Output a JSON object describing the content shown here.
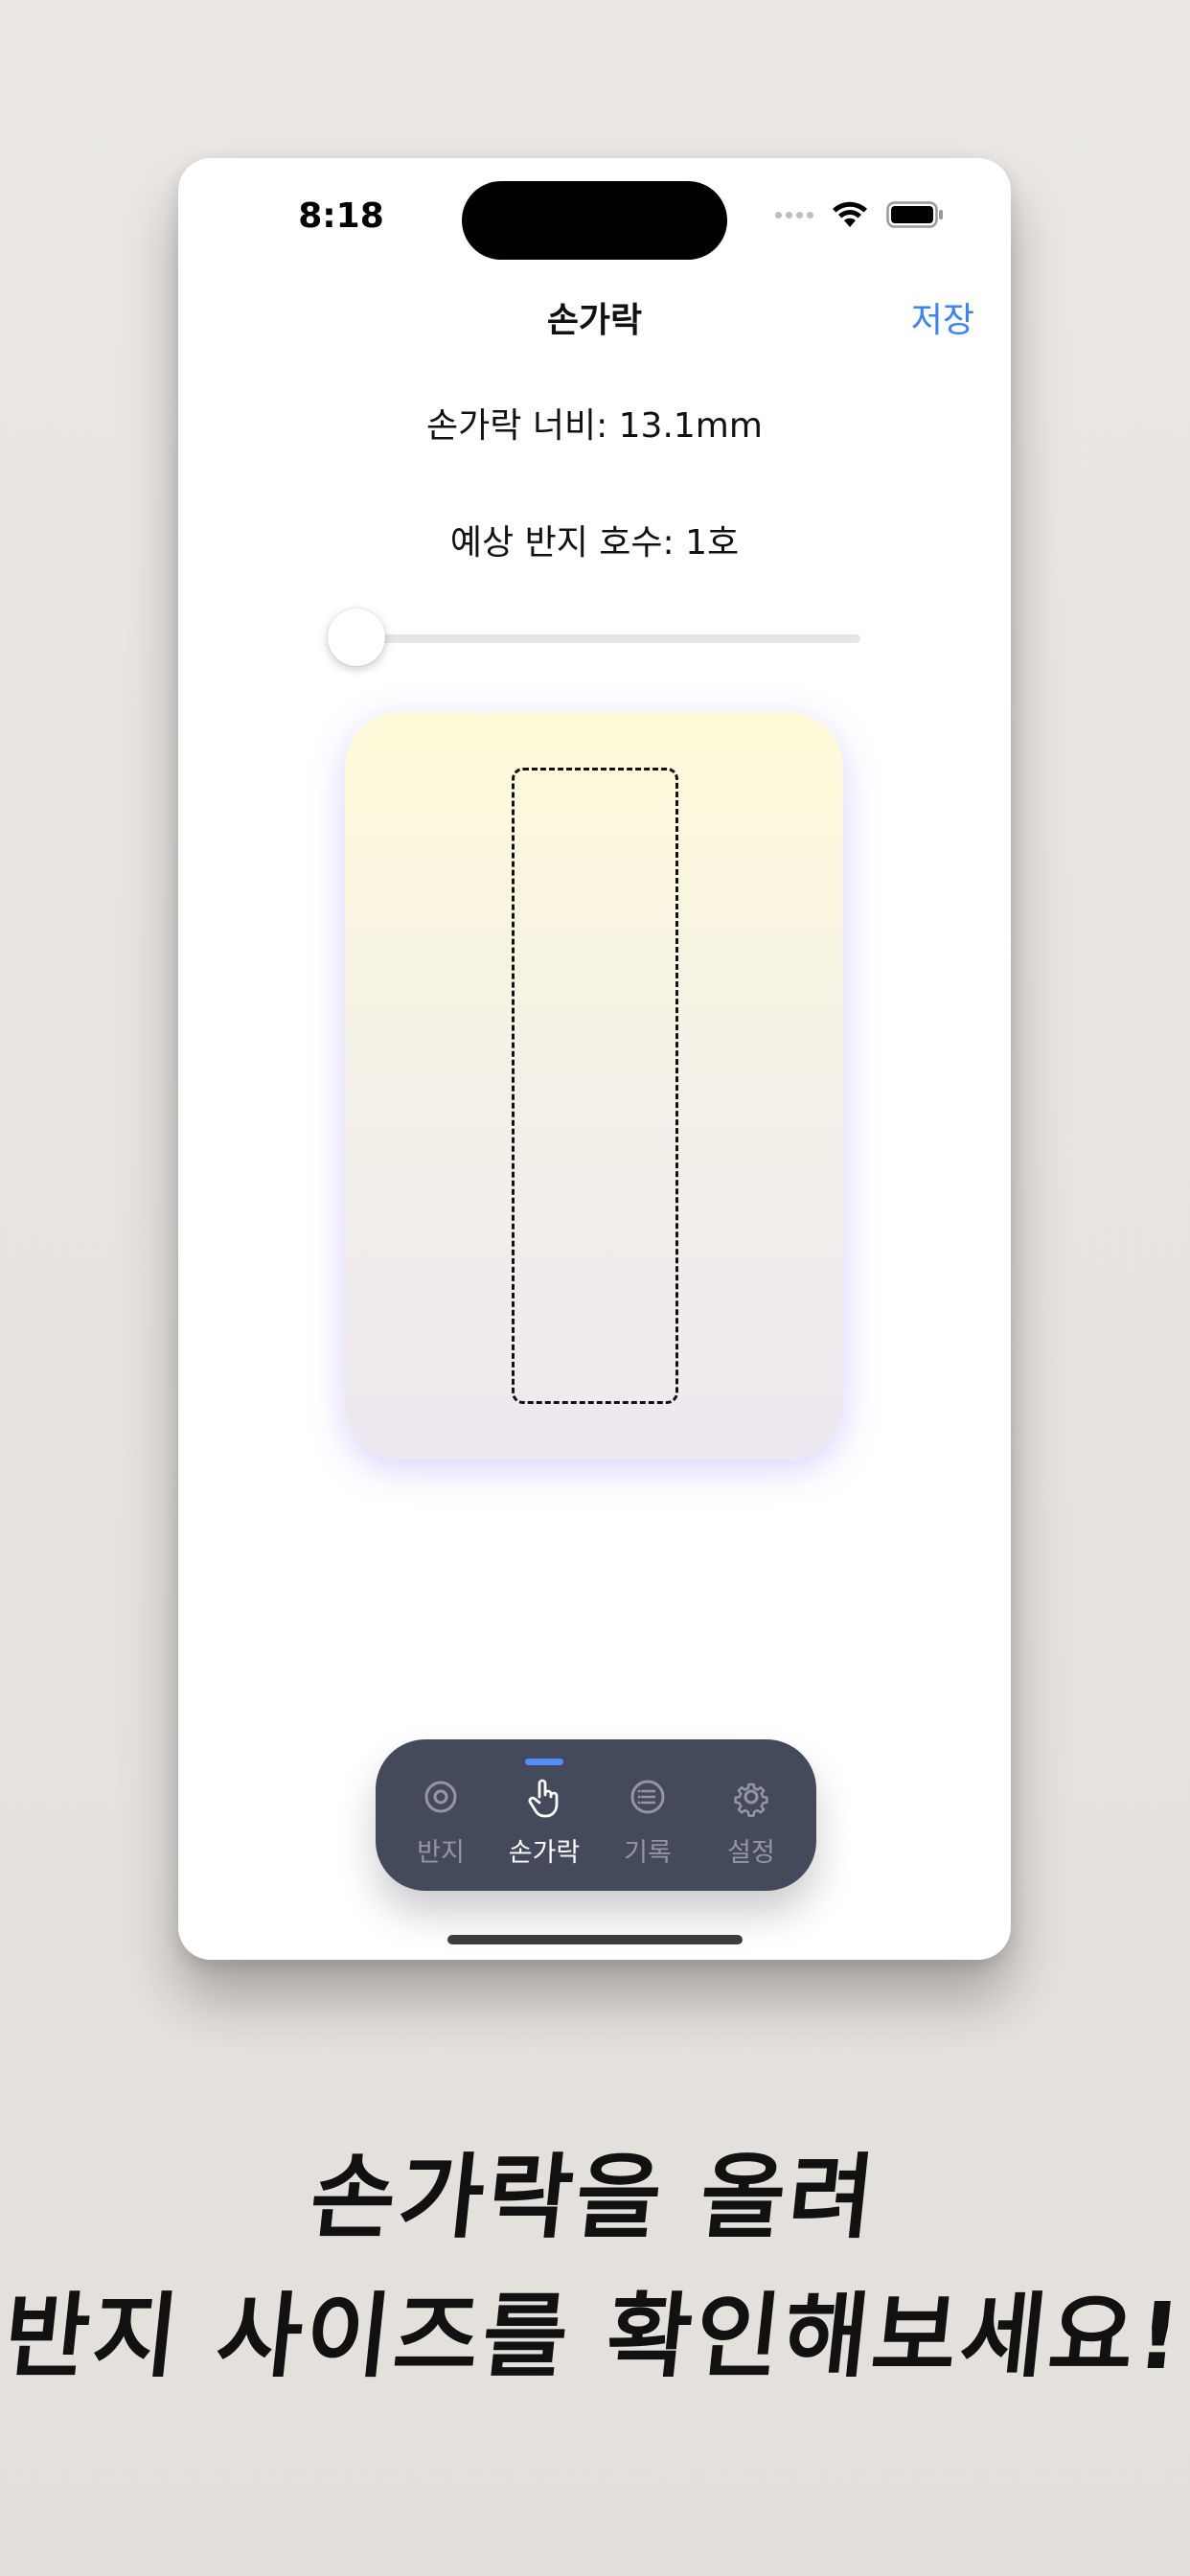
{
  "status_bar": {
    "time": "8:18"
  },
  "nav": {
    "title": "손가락",
    "save_label": "저장"
  },
  "measurement": {
    "width_text": "손가락 너비: 13.1mm",
    "ring_size_text": "예상 반지 호수: 1호"
  },
  "slider": {
    "value_fraction": 0.0
  },
  "tabs": [
    {
      "label": "반지",
      "icon": "ring-icon",
      "active": false
    },
    {
      "label": "손가락",
      "icon": "hand-pointer-icon",
      "active": true
    },
    {
      "label": "기록",
      "icon": "list-icon",
      "active": false
    },
    {
      "label": "설정",
      "icon": "gear-icon",
      "active": false
    }
  ],
  "caption": {
    "line1": "손가락을 올려",
    "line2": "반지 사이즈를 확인해보세요!"
  },
  "colors": {
    "accent": "#3b82f6",
    "tab_bar": "#444a5c",
    "tab_indicator": "#4f8ef7",
    "card_glow": "#9e8aff"
  }
}
